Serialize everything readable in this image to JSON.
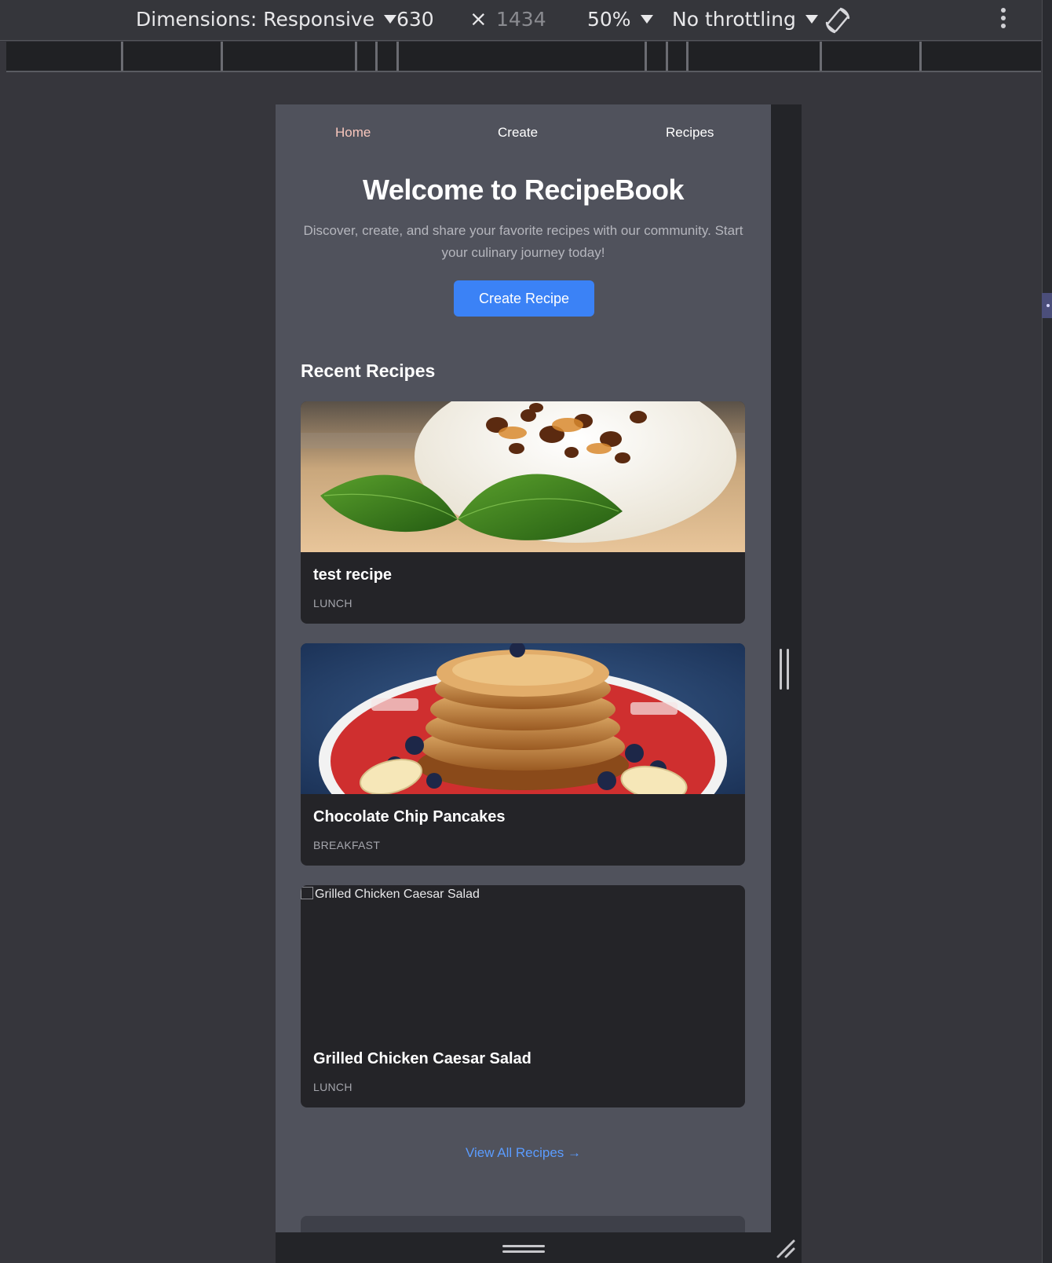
{
  "devtools": {
    "dimensions_label": "Dimensions: Responsive",
    "width_value": "630",
    "times_symbol": "×",
    "height_value": "1434",
    "zoom_label": "50%",
    "throttling_label": "No throttling"
  },
  "nav": {
    "home": "Home",
    "create": "Create",
    "recipes": "Recipes"
  },
  "hero": {
    "title": "Welcome to RecipeBook",
    "subtitle": "Discover, create, and share your favorite recipes with our community. Start your culinary journey today!",
    "cta": "Create Recipe"
  },
  "recent": {
    "heading": "Recent Recipes",
    "cards": [
      {
        "title": "test recipe",
        "category": "LUNCH"
      },
      {
        "title": "Chocolate Chip Pancakes",
        "category": "BREAKFAST"
      },
      {
        "title": "Grilled Chicken Caesar Salad",
        "category": "LUNCH",
        "image_alt": "Grilled Chicken Caesar Salad"
      }
    ],
    "view_all": "View All Recipes →"
  },
  "colors": {
    "accent": "#3b82f6",
    "link": "#5b9cff",
    "active_nav": "#f9c7bd",
    "page_bg": "#50525c",
    "card_bg": "#242428"
  }
}
